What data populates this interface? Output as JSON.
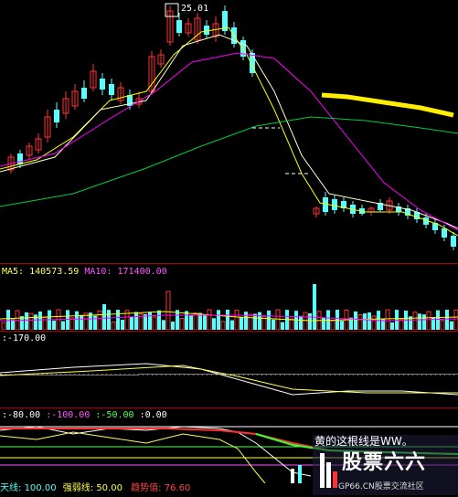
{
  "colors": {
    "up": "#ff3333",
    "down": "#55ffff",
    "ma5": "#ffff00",
    "ma10": "#ff00ff",
    "ma20": "#00cc44",
    "separator": "#b00000",
    "yellow_line": "#ffee00"
  },
  "price_panel": {
    "high_label": "25.01"
  },
  "volume_panel": {
    "ma5_label": "MA5:",
    "ma5_value": "140573.59",
    "ma10_label": "MA10:",
    "ma10_value": "171400.00"
  },
  "macd_panel": {
    "value_label": ":-170.00"
  },
  "osc_panel": {
    "level1": ":-80.00",
    "level2": ":-100.00",
    "level3": ":-50.00",
    "level4": ":0.00",
    "tian_label": "天线:",
    "tian_value": "100.00",
    "strong_label": "强弱线:",
    "strong_value": "50.00",
    "trend_label": "趋势值:",
    "trend_value": "76.60"
  },
  "watermark": {
    "note": "黄的这根线是WW。",
    "title": "股票六六",
    "site": "GP66.CN股票交流社区"
  }
}
